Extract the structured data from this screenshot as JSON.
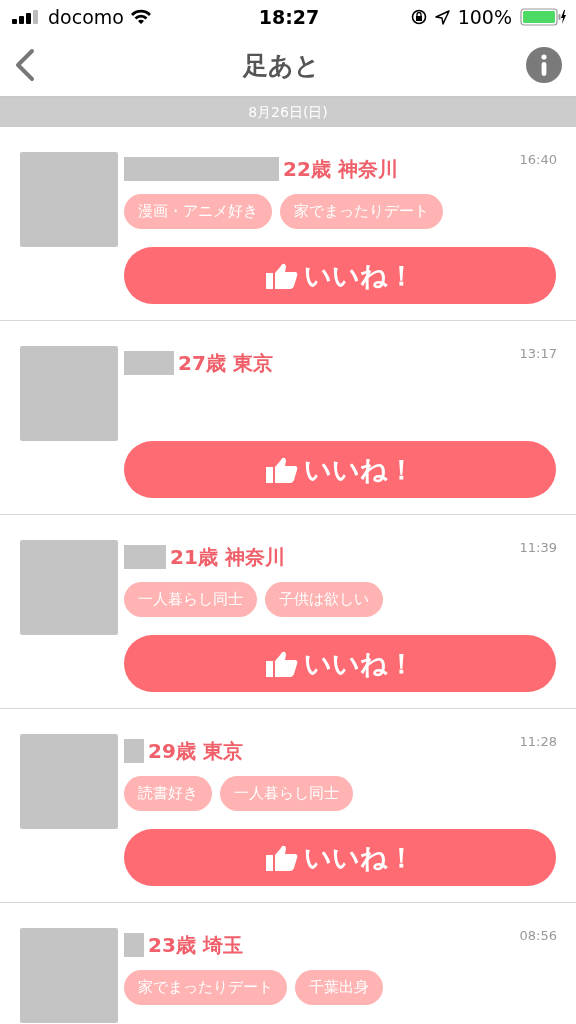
{
  "status_bar": {
    "carrier": "docomo",
    "time": "18:27",
    "battery": "100%"
  },
  "nav": {
    "title": "足あと"
  },
  "date_header": "8月26日(日)",
  "footprints": [
    {
      "age_area": "22歳 神奈川",
      "time": "16:40",
      "tags": [
        "漫画・アニメ好き",
        "家でまったりデート"
      ],
      "like_button": "いいね！"
    },
    {
      "age_area": "27歳 東京",
      "time": "13:17",
      "like_button": "いいね！"
    },
    {
      "age_area": "21歳 神奈川",
      "time": "11:39",
      "tags": [
        "一人暮らし同士",
        "子供は欲しい"
      ],
      "like_button": "いいね！"
    },
    {
      "age_area": "29歳 東京",
      "time": "11:28",
      "tags": [
        "読書好き",
        "一人暮らし同士"
      ],
      "like_button": "いいね！"
    },
    {
      "age_area": "23歳 埼玉",
      "time": "08:56",
      "tags": [
        "家でまったりデート",
        "千葉出身"
      ]
    }
  ]
}
